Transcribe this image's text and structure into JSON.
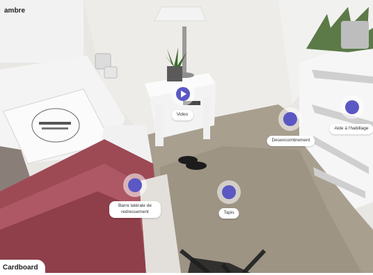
{
  "room": {
    "title": "ambre"
  },
  "hotspots": [
    {
      "id": "video",
      "label": "Video",
      "icon": "play-icon"
    },
    {
      "id": "desencombrement",
      "label": "Desencombrement",
      "icon": "dot-icon"
    },
    {
      "id": "aide-habillage",
      "label": "Aide à l'habillage",
      "icon": "dot-icon"
    },
    {
      "id": "barre-laterale",
      "label": "Barre latérale de redressement",
      "icon": "dot-icon"
    },
    {
      "id": "tapis",
      "label": "Tapis",
      "icon": "dot-icon"
    }
  ],
  "footer": {
    "cardboard_label": "Cardboard"
  },
  "colors": {
    "accent": "#5b58c4",
    "label_bg": "#ffffff"
  }
}
